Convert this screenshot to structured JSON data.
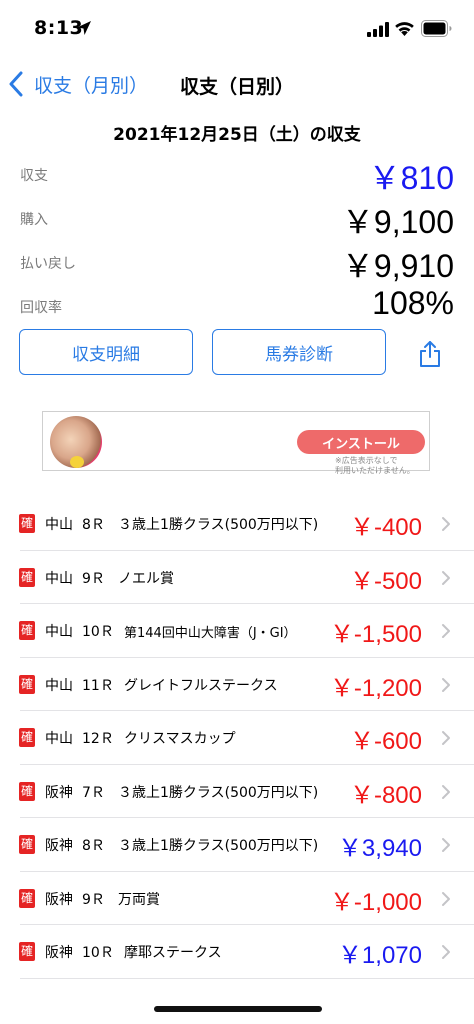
{
  "status_bar": {
    "time": "8:13",
    "icons": [
      "location-arrow-icon",
      "cellular-signal-icon",
      "wifi-icon",
      "battery-icon"
    ]
  },
  "nav": {
    "back_label": "収支（月別）",
    "title": "収支（日別）"
  },
  "date_title": "2021年12月25日（土）の収支",
  "summary": [
    {
      "label": "収支",
      "value": "￥810",
      "color": "#1a1af0"
    },
    {
      "label": "購入",
      "value": "￥9,100",
      "color": "#000000"
    },
    {
      "label": "払い戻し",
      "value": "￥9,910",
      "color": "#000000"
    },
    {
      "label": "回収率",
      "value": "108%",
      "color": "#000000"
    }
  ],
  "buttons": {
    "details": "収支明細",
    "diagnosis": "馬券診断"
  },
  "ad": {
    "install_label": "インストール",
    "note_line1": "※広告表示なしで",
    "note_line2": "利用いただけません。"
  },
  "races": [
    {
      "badge": "確",
      "venue": "中山",
      "race": "8Ｒ",
      "name": "３歳上1勝クラス(500万円以下)",
      "amount": "￥-400",
      "sign": "negative"
    },
    {
      "badge": "確",
      "venue": "中山",
      "race": "9Ｒ",
      "name": "ノエル賞",
      "amount": "￥-500",
      "sign": "negative"
    },
    {
      "badge": "確",
      "venue": "中山",
      "race": "10Ｒ",
      "name": "第144回中山大障害（J・GI）",
      "amount": "￥-1,500",
      "sign": "negative"
    },
    {
      "badge": "確",
      "venue": "中山",
      "race": "11Ｒ",
      "name": "グレイトフルステークス",
      "amount": "￥-1,200",
      "sign": "negative"
    },
    {
      "badge": "確",
      "venue": "中山",
      "race": "12Ｒ",
      "name": "クリスマスカップ",
      "amount": "￥-600",
      "sign": "negative"
    },
    {
      "badge": "確",
      "venue": "阪神",
      "race": "7Ｒ",
      "name": "３歳上1勝クラス(500万円以下)",
      "amount": "￥-800",
      "sign": "negative"
    },
    {
      "badge": "確",
      "venue": "阪神",
      "race": "8Ｒ",
      "name": "３歳上1勝クラス(500万円以下)",
      "amount": "￥3,940",
      "sign": "positive"
    },
    {
      "badge": "確",
      "venue": "阪神",
      "race": "9Ｒ",
      "name": "万両賞",
      "amount": "￥-1,000",
      "sign": "negative"
    },
    {
      "badge": "確",
      "venue": "阪神",
      "race": "10Ｒ",
      "name": "摩耶ステークス",
      "amount": "￥1,070",
      "sign": "positive"
    }
  ],
  "colors": {
    "accent": "#2a7be4",
    "positive": "#1a1af0",
    "negative": "#f01818",
    "badge": "#e52424"
  }
}
